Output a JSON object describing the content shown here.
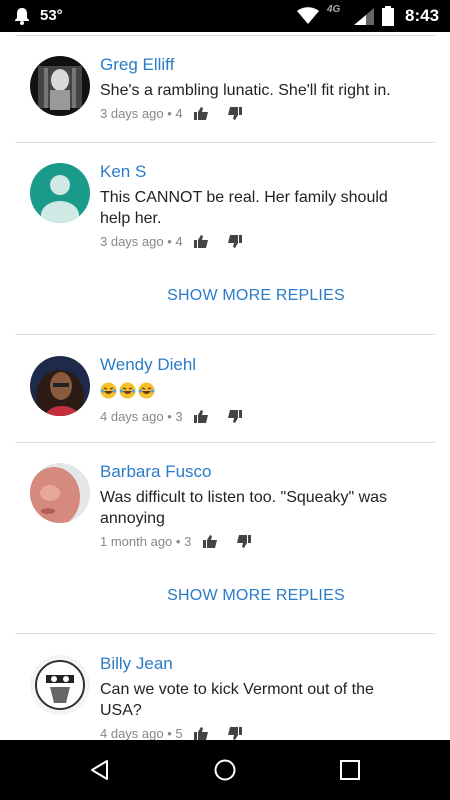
{
  "status_bar": {
    "temperature": "53°",
    "network": "4G",
    "time": "8:43",
    "icons": [
      "notification-bell-icon",
      "wifi-icon",
      "cell-signal-icon",
      "battery-icon"
    ]
  },
  "comments": [
    {
      "author": "Greg Elliff",
      "text": "She's a rambling lunatic.  She'll fit right in.",
      "time": "3 days ago",
      "likes": "4"
    },
    {
      "author": "Ken S",
      "text": "This CANNOT be real. Her family should help her.",
      "time": "3 days ago",
      "likes": "4"
    },
    {
      "author": "Wendy Diehl",
      "text": "😂😂😂",
      "time": "4 days ago",
      "likes": "3"
    },
    {
      "author": "Barbara Fusco",
      "text": "Was difficult to listen too. \"Squeaky\" was annoying",
      "time": "1 month ago",
      "likes": "3"
    },
    {
      "author": "Billy Jean",
      "text": "Can we vote to kick Vermont out of the USA?",
      "time": "4 days ago",
      "likes": "5"
    }
  ],
  "show_more_label": "SHOW MORE REPLIES",
  "separator": "•",
  "colors": {
    "link": "#2a7cc7",
    "text": "#222222",
    "meta": "#888888",
    "divider": "#dcdcdc",
    "bars": "#000000"
  },
  "nav": {
    "icons": [
      "back-icon",
      "home-icon",
      "recent-apps-icon"
    ]
  }
}
